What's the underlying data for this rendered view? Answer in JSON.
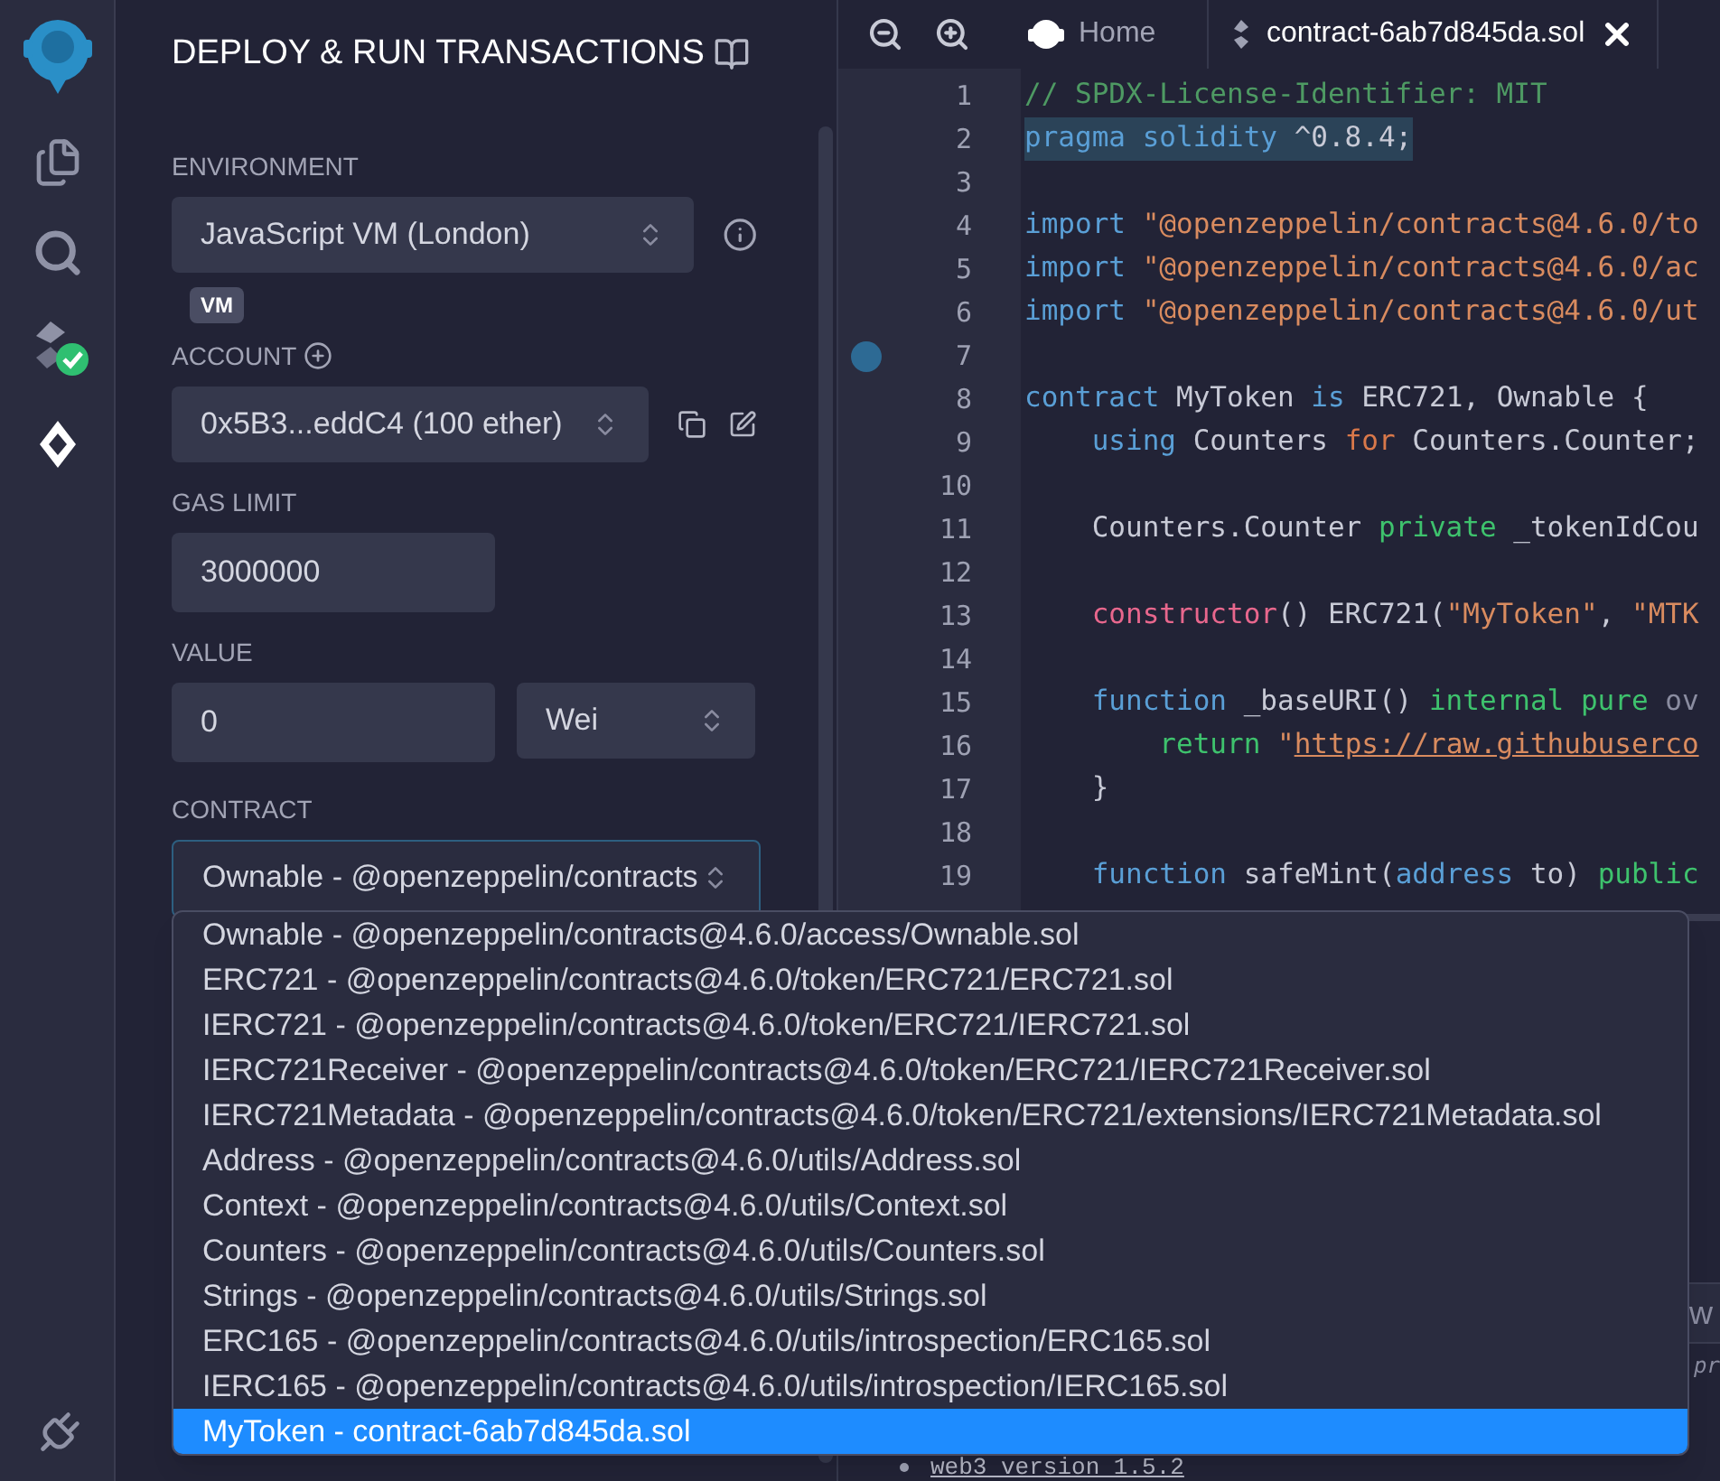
{
  "icon_bar": [
    {
      "kind": "logo",
      "selected": false
    },
    {
      "kind": "files",
      "selected": false
    },
    {
      "kind": "search",
      "selected": false
    },
    {
      "kind": "compiler",
      "selected": false
    },
    {
      "kind": "deploy",
      "selected": true
    },
    {
      "kind": "plugin",
      "selected": false
    }
  ],
  "panel": {
    "title": "DEPLOY & RUN TRANSACTIONS",
    "environment": {
      "label": "ENVIRONMENT",
      "value": "JavaScript VM (London)",
      "badge": "VM"
    },
    "account": {
      "label": "ACCOUNT",
      "value": "0x5B3...eddC4 (100 ether)"
    },
    "gas_limit": {
      "label": "GAS LIMIT",
      "value": "3000000"
    },
    "value": {
      "label": "VALUE",
      "amount": "0",
      "unit": "Wei"
    },
    "contract": {
      "label": "CONTRACT",
      "value": "Ownable - @openzeppelin/contracts",
      "options": [
        {
          "label": "Ownable - @openzeppelin/contracts@4.6.0/access/Ownable.sol",
          "selected": false
        },
        {
          "label": "ERC721 - @openzeppelin/contracts@4.6.0/token/ERC721/ERC721.sol",
          "selected": false
        },
        {
          "label": "IERC721 - @openzeppelin/contracts@4.6.0/token/ERC721/IERC721.sol",
          "selected": false
        },
        {
          "label": "IERC721Receiver - @openzeppelin/contracts@4.6.0/token/ERC721/IERC721Receiver.sol",
          "selected": false
        },
        {
          "label": "IERC721Metadata - @openzeppelin/contracts@4.6.0/token/ERC721/extensions/IERC721Metadata.sol",
          "selected": false
        },
        {
          "label": "Address - @openzeppelin/contracts@4.6.0/utils/Address.sol",
          "selected": false
        },
        {
          "label": "Context - @openzeppelin/contracts@4.6.0/utils/Context.sol",
          "selected": false
        },
        {
          "label": "Counters - @openzeppelin/contracts@4.6.0/utils/Counters.sol",
          "selected": false
        },
        {
          "label": "Strings - @openzeppelin/contracts@4.6.0/utils/Strings.sol",
          "selected": false
        },
        {
          "label": "ERC165 - @openzeppelin/contracts@4.6.0/utils/introspection/ERC165.sol",
          "selected": false
        },
        {
          "label": "IERC165 - @openzeppelin/contracts@4.6.0/utils/introspection/IERC165.sol",
          "selected": false
        },
        {
          "label": "MyToken - contract-6ab7d845da.sol",
          "selected": true
        }
      ]
    }
  },
  "editor": {
    "tabs": [
      {
        "kind": "home",
        "label": "Home",
        "selected": false
      },
      {
        "kind": "file",
        "label": "contract-6ab7d845da.sol",
        "selected": true
      }
    ],
    "lines": [
      {
        "number": "1",
        "selected": false,
        "breakpoint": false,
        "tokens": [
          {
            "kind": "comment",
            "text": "// SPDX-License-Identifier: MIT"
          }
        ]
      },
      {
        "number": "2",
        "selected": true,
        "breakpoint": false,
        "tokens": [
          {
            "kind": "keyword",
            "text": "pragma solidity"
          },
          {
            "kind": "plain",
            "text": " ^0.8.4;"
          }
        ]
      },
      {
        "number": "3",
        "selected": false,
        "breakpoint": false
      },
      {
        "number": "4",
        "selected": false,
        "breakpoint": false,
        "tokens": [
          {
            "kind": "keyword",
            "text": "import"
          },
          {
            "kind": "string",
            "text": " \"@openzeppelin/contracts@4.6.0/to"
          }
        ]
      },
      {
        "number": "5",
        "selected": false,
        "breakpoint": false,
        "tokens": [
          {
            "kind": "keyword",
            "text": "import"
          },
          {
            "kind": "string",
            "text": " \"@openzeppelin/contracts@4.6.0/ac"
          }
        ]
      },
      {
        "number": "6",
        "selected": false,
        "breakpoint": false,
        "tokens": [
          {
            "kind": "keyword",
            "text": "import"
          },
          {
            "kind": "string",
            "text": " \"@openzeppelin/contracts@4.6.0/ut"
          }
        ]
      },
      {
        "number": "7",
        "selected": false,
        "breakpoint": true
      },
      {
        "number": "8",
        "selected": false,
        "breakpoint": false,
        "tokens": [
          {
            "kind": "keyword",
            "text": "contract"
          },
          {
            "kind": "plain",
            "text": " MyToken "
          },
          {
            "kind": "keyword",
            "text": "is"
          },
          {
            "kind": "plain",
            "text": " ERC721, Ownable {"
          }
        ]
      },
      {
        "number": "9",
        "selected": false,
        "breakpoint": false,
        "tokens": [
          {
            "kind": "keyword",
            "text": "    using"
          },
          {
            "kind": "plain",
            "text": " Counters "
          },
          {
            "kind": "control",
            "text": "for"
          },
          {
            "kind": "plain",
            "text": " Counters.Counter;"
          }
        ]
      },
      {
        "number": "10",
        "selected": false,
        "breakpoint": false
      },
      {
        "number": "11",
        "selected": false,
        "breakpoint": false,
        "tokens": [
          {
            "kind": "plain",
            "text": "    Counters.Counter "
          },
          {
            "kind": "modifier",
            "text": "private"
          },
          {
            "kind": "plain",
            "text": " _tokenIdCou"
          }
        ]
      },
      {
        "number": "12",
        "selected": false,
        "breakpoint": false
      },
      {
        "number": "13",
        "selected": false,
        "breakpoint": false,
        "tokens": [
          {
            "kind": "special",
            "text": "    constructor"
          },
          {
            "kind": "plain",
            "text": "() ERC721("
          },
          {
            "kind": "string",
            "text": "\"MyToken\""
          },
          {
            "kind": "plain",
            "text": ", "
          },
          {
            "kind": "string",
            "text": "\"MTK"
          }
        ]
      },
      {
        "number": "14",
        "selected": false,
        "breakpoint": false
      },
      {
        "number": "15",
        "selected": false,
        "breakpoint": false,
        "tokens": [
          {
            "kind": "keyword",
            "text": "    function"
          },
          {
            "kind": "plain",
            "text": " _baseURI() "
          },
          {
            "kind": "modifier",
            "text": "internal pure"
          },
          {
            "kind": "dim",
            "text": " ov"
          }
        ]
      },
      {
        "number": "16",
        "selected": false,
        "breakpoint": false,
        "tokens": [
          {
            "kind": "modifier",
            "text": "        return"
          },
          {
            "kind": "string",
            "text": " \""
          },
          {
            "kind": "link",
            "text": "https://raw.githubuserco"
          }
        ]
      },
      {
        "number": "17",
        "selected": false,
        "breakpoint": false,
        "tokens": [
          {
            "kind": "plain",
            "text": "    }"
          }
        ]
      },
      {
        "number": "18",
        "selected": false,
        "breakpoint": false
      },
      {
        "number": "19",
        "selected": false,
        "breakpoint": false,
        "tokens": [
          {
            "kind": "keyword",
            "text": "    function"
          },
          {
            "kind": "plain",
            "text": " safeMint("
          },
          {
            "kind": "keyword",
            "text": "address"
          },
          {
            "kind": "plain",
            "text": " to) "
          },
          {
            "kind": "modifier",
            "text": "public"
          }
        ]
      }
    ]
  },
  "terminal": {
    "tab_fragment": "w",
    "line_fragment": "pr",
    "list_item": "web3 version 1.5.2"
  }
}
